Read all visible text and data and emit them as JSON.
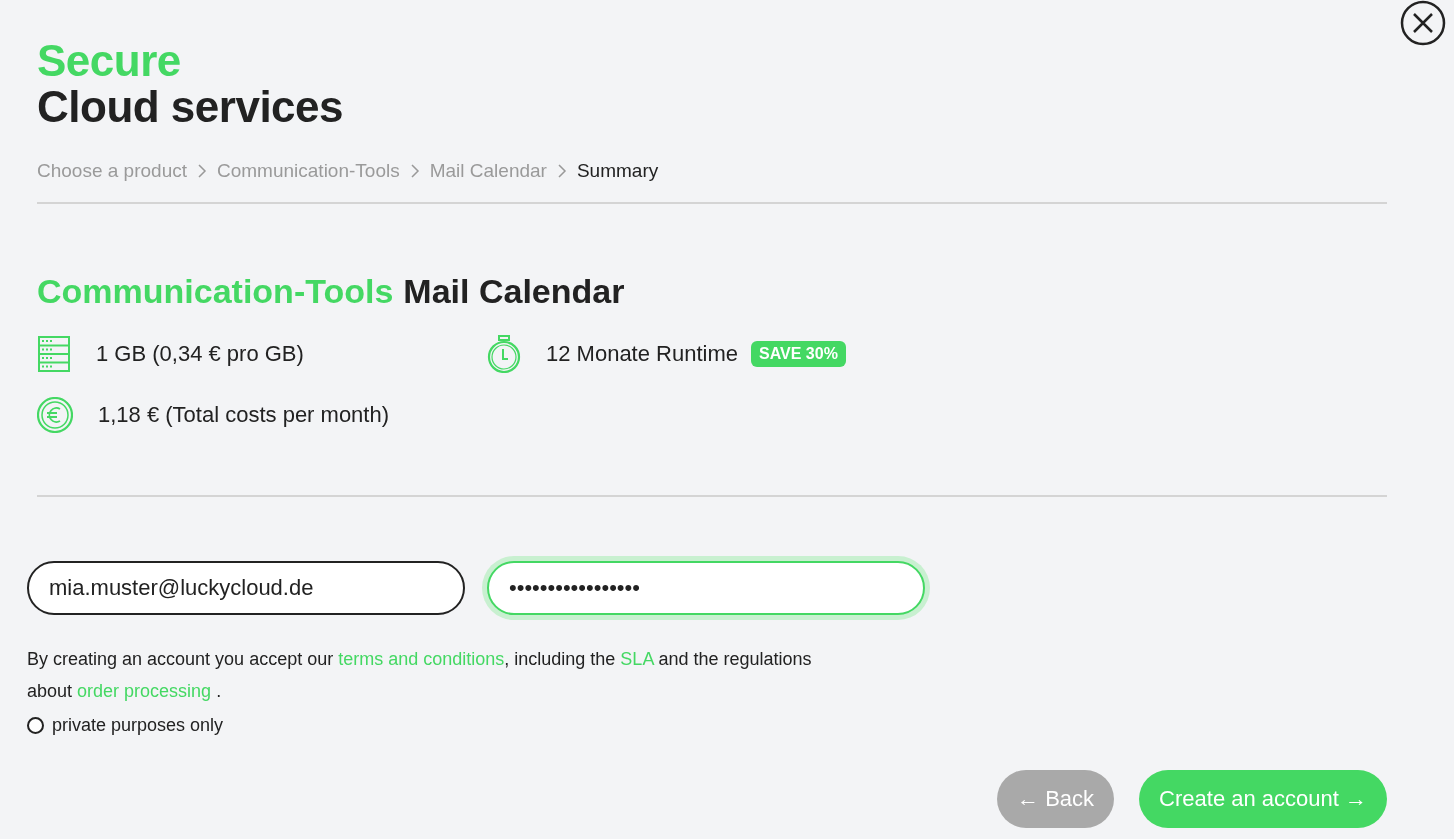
{
  "header": {
    "title_accent": "Secure",
    "title": "Cloud services"
  },
  "breadcrumb": [
    {
      "label": "Choose a product",
      "selected": false
    },
    {
      "label": "Communication-Tools",
      "selected": false
    },
    {
      "label": "Mail Calendar",
      "selected": false
    },
    {
      "label": "Summary",
      "selected": true
    }
  ],
  "product": {
    "category": "Communication-Tools",
    "name": "Mail Calendar"
  },
  "features": [
    {
      "kind": "storage",
      "text": "1 GB (0,34 € pro GB)"
    },
    {
      "kind": "runtime",
      "text": "12 Monate Runtime",
      "badge": "SAVE 30%"
    },
    {
      "kind": "cost",
      "text": "1,18 € (Total costs per month)"
    }
  ],
  "form": {
    "email": {
      "value": "mia.muster@luckycloud.de",
      "focused": false
    },
    "password": {
      "value": "•••••••••••••••••",
      "focused": true
    }
  },
  "terms": [
    {
      "kind": "text",
      "text": "By creating an account you accept our "
    },
    {
      "kind": "link",
      "text": "terms and conditions"
    },
    {
      "kind": "text",
      "text": ", including the "
    },
    {
      "kind": "link",
      "text": "SLA"
    },
    {
      "kind": "text",
      "text": " and the regulations about "
    },
    {
      "kind": "link",
      "text": "order processing"
    },
    {
      "kind": "text",
      "text": " ."
    }
  ],
  "private_option": {
    "label": "private purposes only",
    "selected": false
  },
  "buttons": [
    {
      "label": "← Back",
      "disabled": true
    },
    {
      "label": "Create an account →",
      "disabled": false
    }
  ]
}
